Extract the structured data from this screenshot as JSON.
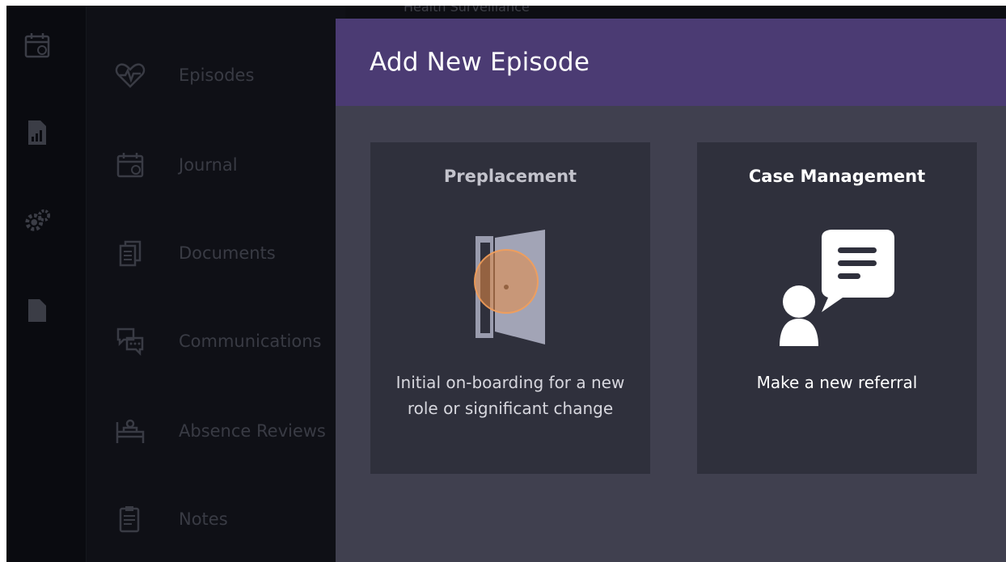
{
  "nav": {
    "top_partial": "Health Surveillance",
    "items": [
      {
        "label": "Episodes",
        "icon": "heart-pulse-icon"
      },
      {
        "label": "Journal",
        "icon": "calendar-icon"
      },
      {
        "label": "Documents",
        "icon": "documents-icon"
      },
      {
        "label": "Communications",
        "icon": "chat-bubbles-icon"
      },
      {
        "label": "Absence Reviews",
        "icon": "bed-icon"
      },
      {
        "label": "Notes",
        "icon": "notes-icon"
      }
    ]
  },
  "rail": {
    "icons": [
      "calendar-icon",
      "report-icon",
      "settings-gear-icon",
      "file-icon"
    ]
  },
  "modal": {
    "title": "Add New Episode",
    "cards": [
      {
        "title": "Preplacement",
        "description_line1": "Initial on-boarding for a new",
        "description_line2": "role or significant change",
        "icon": "open-door-icon"
      },
      {
        "title": "Case Management",
        "description_line1": "Make a new referral",
        "icon": "person-speech-bubble-icon"
      }
    ]
  },
  "colors": {
    "modal_header": "#4b3b73",
    "modal_body": "#40404f",
    "card_bg": "#2f303c",
    "cursor_highlight": "#e78c46"
  }
}
